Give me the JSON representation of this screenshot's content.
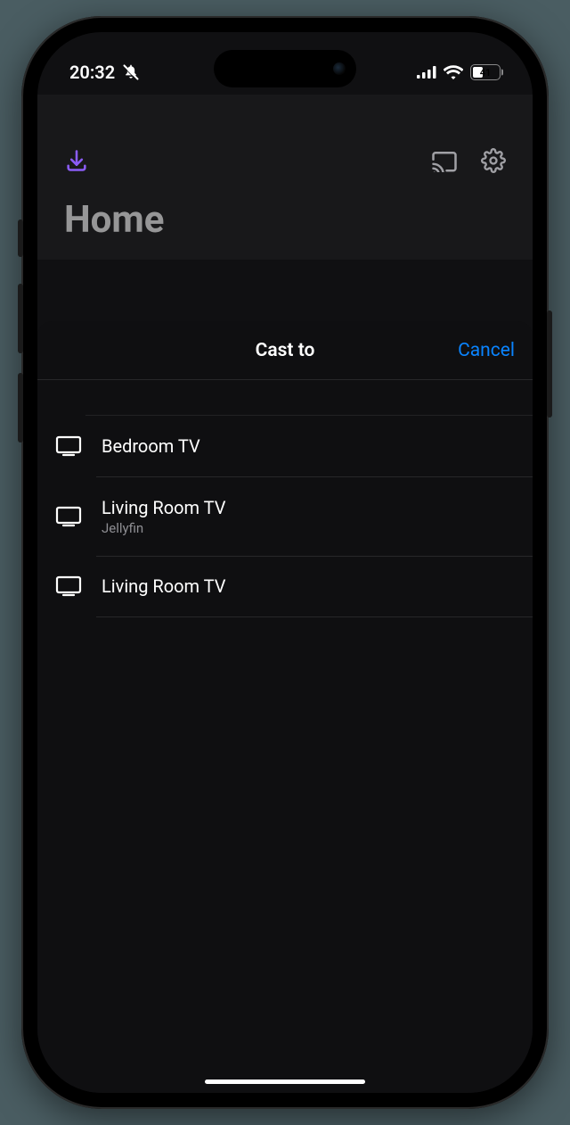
{
  "status": {
    "time": "20:32",
    "battery_pct": "41"
  },
  "header": {
    "title": "Home"
  },
  "sheet": {
    "title": "Cast to",
    "cancel": "Cancel",
    "devices": [
      {
        "name": "Bedroom TV",
        "sub": ""
      },
      {
        "name": "Living Room TV",
        "sub": "Jellyfin"
      },
      {
        "name": "Living Room TV",
        "sub": ""
      }
    ]
  }
}
